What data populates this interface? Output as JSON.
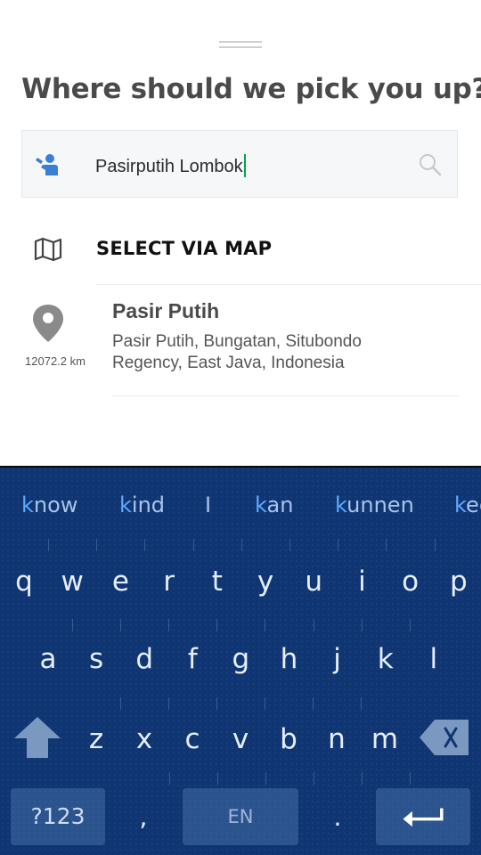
{
  "header": {
    "title": "Where should we pick you up?"
  },
  "search": {
    "value": "Pasirputih Lombok",
    "icon_left": "person-pin-icon",
    "icon_right": "search-icon"
  },
  "select_map": {
    "label": "SELECT VIA MAP",
    "icon": "map-icon"
  },
  "results": [
    {
      "name": "Pasir Putih",
      "address": "Pasir Putih, Bungatan, Situbondo Regency, East Java, Indonesia",
      "distance": "12072.2 km",
      "icon": "location-pin-icon"
    }
  ],
  "keyboard": {
    "suggestions": [
      {
        "prefix": "k",
        "rest": "now"
      },
      {
        "prefix": "k",
        "rest": "ind"
      },
      {
        "prefix": "",
        "rest": "I"
      },
      {
        "prefix": "k",
        "rest": "an"
      },
      {
        "prefix": "k",
        "rest": "unnen"
      },
      {
        "prefix": "k",
        "rest": "ee"
      }
    ],
    "row1": [
      "q",
      "w",
      "e",
      "r",
      "t",
      "y",
      "u",
      "i",
      "o",
      "p"
    ],
    "row2": [
      "a",
      "s",
      "d",
      "f",
      "g",
      "h",
      "j",
      "k",
      "l"
    ],
    "row3": [
      "z",
      "x",
      "c",
      "v",
      "b",
      "n",
      "m"
    ],
    "symbols_label": "?123",
    "comma": ",",
    "space_label": "EN",
    "period": ".",
    "colors": {
      "background": "#0f3572",
      "highlight": "#5fa8ff"
    }
  }
}
